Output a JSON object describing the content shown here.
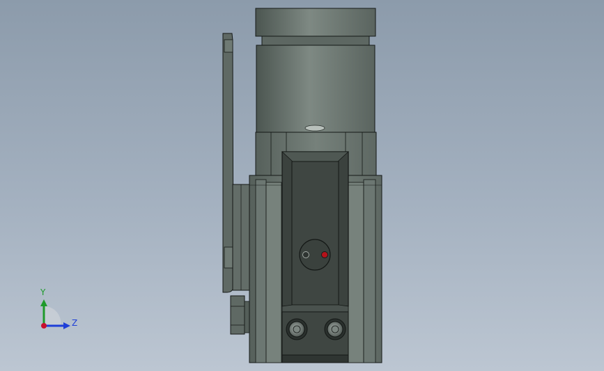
{
  "triad": {
    "y_label": "Y",
    "z_label": "Z",
    "y_color": "#1f9a2b",
    "z_color": "#1f3fd8",
    "origin_color": "#c8102e"
  },
  "model": {
    "body_color": "#6f7a74",
    "edge_color": "#141816",
    "indicator_color": "#b4121a"
  }
}
